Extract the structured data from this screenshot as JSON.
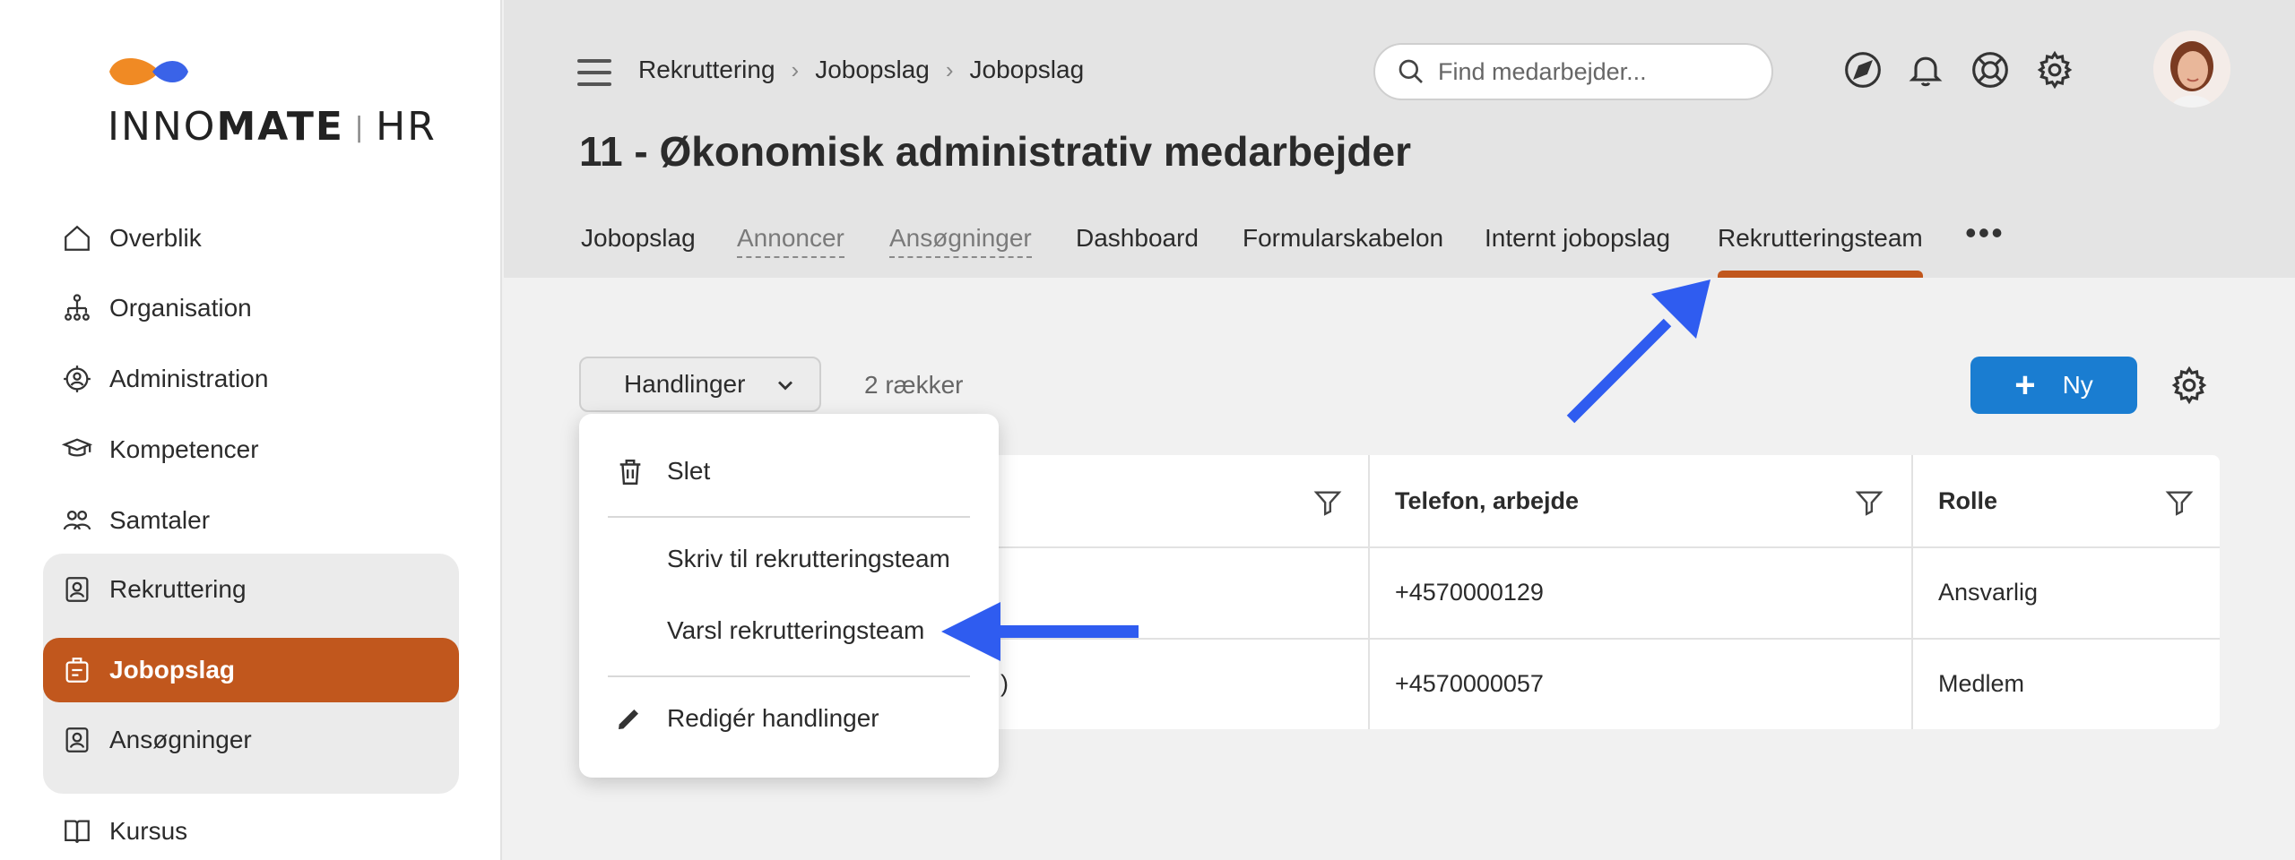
{
  "brand": {
    "logo_text_light": "INNO",
    "logo_text_bold": "MATE",
    "logo_text_suffix": " HR"
  },
  "sidebar": {
    "items": [
      {
        "label": "Overblik",
        "icon": "home-icon"
      },
      {
        "label": "Organisation",
        "icon": "org-chart-icon"
      },
      {
        "label": "Administration",
        "icon": "gear-person-icon"
      },
      {
        "label": "Kompetencer",
        "icon": "graduation-cap-icon"
      },
      {
        "label": "Samtaler",
        "icon": "people-icon"
      },
      {
        "label": "Rekruttering",
        "icon": "id-badge-icon"
      },
      {
        "label": "Jobopslag",
        "icon": "job-posting-icon"
      },
      {
        "label": "Ansøgninger",
        "icon": "id-badge-icon"
      },
      {
        "label": "Kursus",
        "icon": "book-icon"
      }
    ]
  },
  "header": {
    "breadcrumb": [
      "Rekruttering",
      "Jobopslag",
      "Jobopslag"
    ],
    "search_placeholder": "Find medarbejder...",
    "title": "11 - Økonomisk administrativ medarbejder"
  },
  "tabs": [
    {
      "label": "Jobopslag"
    },
    {
      "label": "Annoncer"
    },
    {
      "label": "Ansøgninger"
    },
    {
      "label": "Dashboard"
    },
    {
      "label": "Formularskabelon"
    },
    {
      "label": "Internt jobopslag"
    },
    {
      "label": "Rekrutteringsteam"
    }
  ],
  "tabs_more": "•••",
  "toolbar": {
    "actions_label": "Handlinger",
    "row_count": "2 rækker",
    "new_label": "Ny"
  },
  "table": {
    "columns": [
      "Telefon, arbejde",
      "Rolle"
    ],
    "rows": [
      {
        "name_fragment": "",
        "phone": "+4570000129",
        "role": "Ansvarlig"
      },
      {
        "name_fragment": ")",
        "phone": "+4570000057",
        "role": "Medlem"
      }
    ]
  },
  "dropdown": {
    "items": [
      "Slet",
      "Skriv til rekrutteringsteam",
      "Varsl rekrutteringsteam",
      "Redigér handlinger"
    ]
  },
  "colors": {
    "accent": "#c1571d",
    "primary": "#1a7dd1",
    "annotation_arrow": "#2f5cf0"
  }
}
